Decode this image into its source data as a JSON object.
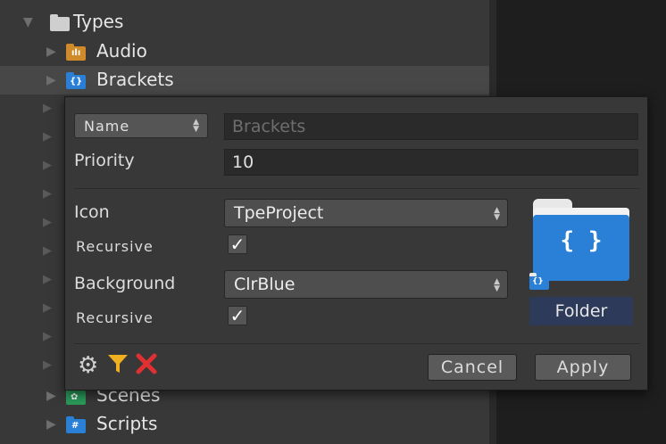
{
  "tree": {
    "root": {
      "label": "Types",
      "icon": "folder-icon"
    },
    "items": [
      {
        "label": "Audio",
        "icon": "audio-folder-icon",
        "color": "#d08a2a"
      },
      {
        "label": "Brackets",
        "icon": "brackets-folder-icon",
        "color": "#2a7fd6"
      },
      {
        "label": "Scenes",
        "icon": "scenes-folder-icon",
        "color": "#2a9a5a"
      },
      {
        "label": "Scripts",
        "icon": "scripts-folder-icon",
        "color": "#2a7fd6"
      }
    ]
  },
  "popup": {
    "name_dropdown": "Name",
    "name_placeholder": "Brackets",
    "priority_label": "Priority",
    "priority_value": "10",
    "icon_label": "Icon",
    "icon_value": "TpeProject",
    "icon_recursive_label": "Recursive",
    "icon_recursive_checked": true,
    "background_label": "Background",
    "background_value": "ClrBlue",
    "background_recursive_label": "Recursive",
    "background_recursive_checked": true,
    "preview": {
      "label": "Folder",
      "glyph": "{ }",
      "color": "#2a7fd6",
      "label_bg": "#2d3a5a"
    },
    "toolbar": {
      "settings_icon": "gear-icon",
      "filter_icon": "filter-icon",
      "clear_icon": "close-icon"
    },
    "cancel_label": "Cancel",
    "apply_label": "Apply"
  }
}
